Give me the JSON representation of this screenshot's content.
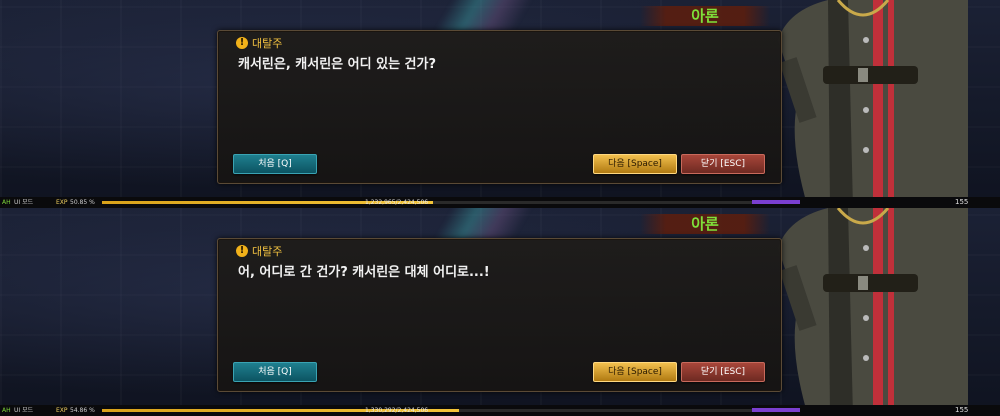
{
  "panels": [
    {
      "npc_name": "아론",
      "quest": "대탈주",
      "dialog": "캐서린은, 캐서린은 어디 있는 건가?",
      "buttons": {
        "first": "처음 [Q]",
        "next": "다음 [Space]",
        "close": "닫기 [ESC]"
      },
      "hud": {
        "auto": "AH",
        "ui_mode": "UI 모드",
        "exp_label": "EXP",
        "exp_percent": "50.85 %",
        "exp_value": "1,232,965/2,424,506",
        "exp_fraction": 0.5085,
        "level": "155"
      }
    },
    {
      "npc_name": "아론",
      "quest": "대탈주",
      "dialog": "어, 어디로 간 건가? 캐서린은 대체 어디로...!",
      "buttons": {
        "first": "처음 [Q]",
        "next": "다음 [Space]",
        "close": "닫기 [ESC]"
      },
      "hud": {
        "auto": "AH",
        "ui_mode": "UI 모드",
        "exp_label": "EXP",
        "exp_percent": "54.86 %",
        "exp_value": "1,330,292/2,424,506",
        "exp_fraction": 0.5486,
        "level": "155"
      }
    }
  ],
  "colors": {
    "npc_name": "#7fe03a",
    "quest": "#f0c040",
    "exp_bar": "#f3c438"
  }
}
